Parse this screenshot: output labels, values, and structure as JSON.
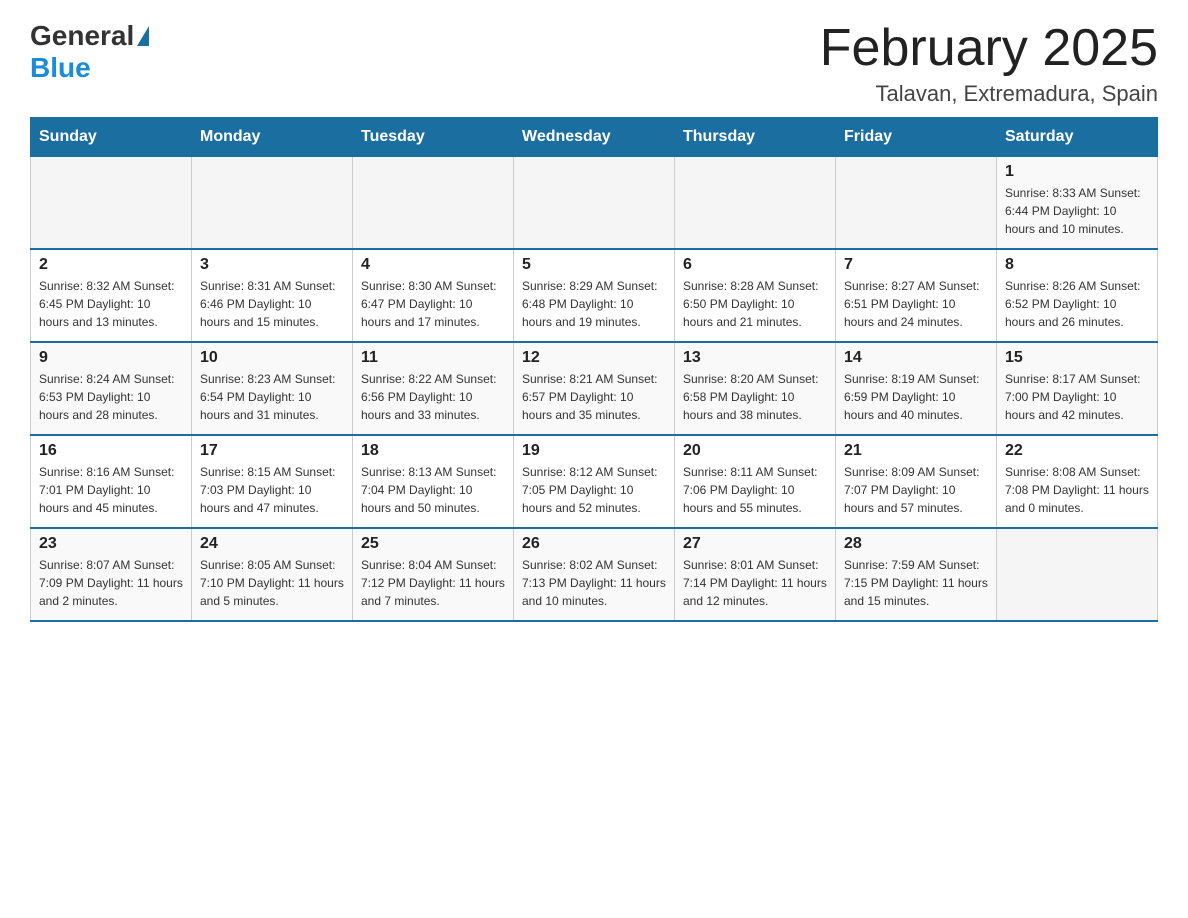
{
  "logo": {
    "general": "General",
    "blue": "Blue"
  },
  "title": "February 2025",
  "subtitle": "Talavan, Extremadura, Spain",
  "days_header": [
    "Sunday",
    "Monday",
    "Tuesday",
    "Wednesday",
    "Thursday",
    "Friday",
    "Saturday"
  ],
  "weeks": [
    [
      {
        "day": "",
        "info": ""
      },
      {
        "day": "",
        "info": ""
      },
      {
        "day": "",
        "info": ""
      },
      {
        "day": "",
        "info": ""
      },
      {
        "day": "",
        "info": ""
      },
      {
        "day": "",
        "info": ""
      },
      {
        "day": "1",
        "info": "Sunrise: 8:33 AM\nSunset: 6:44 PM\nDaylight: 10 hours\nand 10 minutes."
      }
    ],
    [
      {
        "day": "2",
        "info": "Sunrise: 8:32 AM\nSunset: 6:45 PM\nDaylight: 10 hours\nand 13 minutes."
      },
      {
        "day": "3",
        "info": "Sunrise: 8:31 AM\nSunset: 6:46 PM\nDaylight: 10 hours\nand 15 minutes."
      },
      {
        "day": "4",
        "info": "Sunrise: 8:30 AM\nSunset: 6:47 PM\nDaylight: 10 hours\nand 17 minutes."
      },
      {
        "day": "5",
        "info": "Sunrise: 8:29 AM\nSunset: 6:48 PM\nDaylight: 10 hours\nand 19 minutes."
      },
      {
        "day": "6",
        "info": "Sunrise: 8:28 AM\nSunset: 6:50 PM\nDaylight: 10 hours\nand 21 minutes."
      },
      {
        "day": "7",
        "info": "Sunrise: 8:27 AM\nSunset: 6:51 PM\nDaylight: 10 hours\nand 24 minutes."
      },
      {
        "day": "8",
        "info": "Sunrise: 8:26 AM\nSunset: 6:52 PM\nDaylight: 10 hours\nand 26 minutes."
      }
    ],
    [
      {
        "day": "9",
        "info": "Sunrise: 8:24 AM\nSunset: 6:53 PM\nDaylight: 10 hours\nand 28 minutes."
      },
      {
        "day": "10",
        "info": "Sunrise: 8:23 AM\nSunset: 6:54 PM\nDaylight: 10 hours\nand 31 minutes."
      },
      {
        "day": "11",
        "info": "Sunrise: 8:22 AM\nSunset: 6:56 PM\nDaylight: 10 hours\nand 33 minutes."
      },
      {
        "day": "12",
        "info": "Sunrise: 8:21 AM\nSunset: 6:57 PM\nDaylight: 10 hours\nand 35 minutes."
      },
      {
        "day": "13",
        "info": "Sunrise: 8:20 AM\nSunset: 6:58 PM\nDaylight: 10 hours\nand 38 minutes."
      },
      {
        "day": "14",
        "info": "Sunrise: 8:19 AM\nSunset: 6:59 PM\nDaylight: 10 hours\nand 40 minutes."
      },
      {
        "day": "15",
        "info": "Sunrise: 8:17 AM\nSunset: 7:00 PM\nDaylight: 10 hours\nand 42 minutes."
      }
    ],
    [
      {
        "day": "16",
        "info": "Sunrise: 8:16 AM\nSunset: 7:01 PM\nDaylight: 10 hours\nand 45 minutes."
      },
      {
        "day": "17",
        "info": "Sunrise: 8:15 AM\nSunset: 7:03 PM\nDaylight: 10 hours\nand 47 minutes."
      },
      {
        "day": "18",
        "info": "Sunrise: 8:13 AM\nSunset: 7:04 PM\nDaylight: 10 hours\nand 50 minutes."
      },
      {
        "day": "19",
        "info": "Sunrise: 8:12 AM\nSunset: 7:05 PM\nDaylight: 10 hours\nand 52 minutes."
      },
      {
        "day": "20",
        "info": "Sunrise: 8:11 AM\nSunset: 7:06 PM\nDaylight: 10 hours\nand 55 minutes."
      },
      {
        "day": "21",
        "info": "Sunrise: 8:09 AM\nSunset: 7:07 PM\nDaylight: 10 hours\nand 57 minutes."
      },
      {
        "day": "22",
        "info": "Sunrise: 8:08 AM\nSunset: 7:08 PM\nDaylight: 11 hours\nand 0 minutes."
      }
    ],
    [
      {
        "day": "23",
        "info": "Sunrise: 8:07 AM\nSunset: 7:09 PM\nDaylight: 11 hours\nand 2 minutes."
      },
      {
        "day": "24",
        "info": "Sunrise: 8:05 AM\nSunset: 7:10 PM\nDaylight: 11 hours\nand 5 minutes."
      },
      {
        "day": "25",
        "info": "Sunrise: 8:04 AM\nSunset: 7:12 PM\nDaylight: 11 hours\nand 7 minutes."
      },
      {
        "day": "26",
        "info": "Sunrise: 8:02 AM\nSunset: 7:13 PM\nDaylight: 11 hours\nand 10 minutes."
      },
      {
        "day": "27",
        "info": "Sunrise: 8:01 AM\nSunset: 7:14 PM\nDaylight: 11 hours\nand 12 minutes."
      },
      {
        "day": "28",
        "info": "Sunrise: 7:59 AM\nSunset: 7:15 PM\nDaylight: 11 hours\nand 15 minutes."
      },
      {
        "day": "",
        "info": ""
      }
    ]
  ]
}
